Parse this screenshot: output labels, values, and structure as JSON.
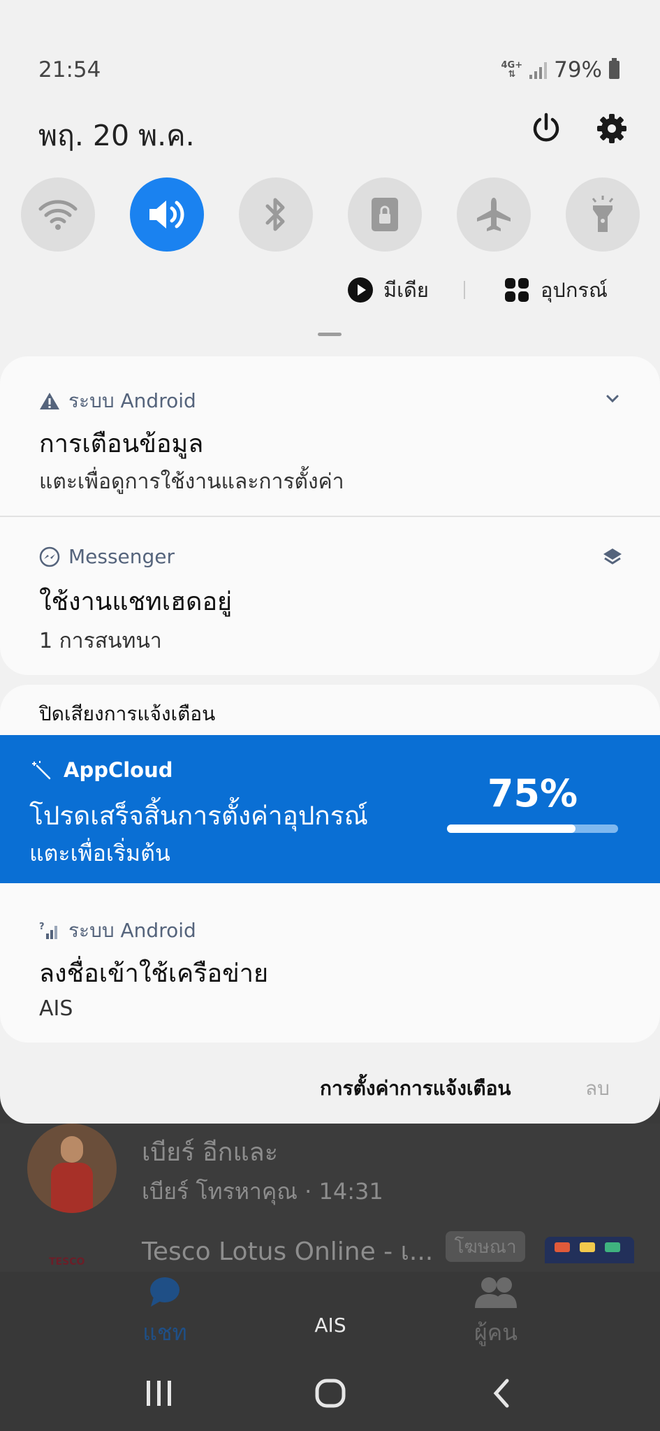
{
  "status_bar": {
    "time": "21:54",
    "network_type": "4G+",
    "battery": "79%"
  },
  "header": {
    "date": "พฤ. 20 พ.ค."
  },
  "quick_settings": [
    {
      "name": "wifi-icon",
      "active": false
    },
    {
      "name": "sound-icon",
      "active": true
    },
    {
      "name": "bluetooth-icon",
      "active": false
    },
    {
      "name": "screen-lock-icon",
      "active": false
    },
    {
      "name": "airplane-icon",
      "active": false
    },
    {
      "name": "flashlight-icon",
      "active": false
    }
  ],
  "media_row": {
    "media_label": "มีเดีย",
    "devices_label": "อุปกรณ์"
  },
  "notifications": {
    "android_alert": {
      "app": "ระบบ Android",
      "title": "การเตือนข้อมูล",
      "text": "แตะเพื่อดูการใช้งานและการตั้งค่า"
    },
    "messenger": {
      "app": "Messenger",
      "title": "ใช้งานแชทเฮดอยู่",
      "text": "1 การสนทนา"
    },
    "silent_section_title": "ปิดเสียงการแจ้งเตือน",
    "appcloud": {
      "app": "AppCloud",
      "title": "โปรดเสร็จสิ้นการตั้งค่าอุปกรณ์",
      "text": "แตะเพื่อเริ่มต้น",
      "progress_label": "75%",
      "progress_fraction": 0.75
    },
    "android_network": {
      "app": "ระบบ Android",
      "title": "ลงชื่อเข้าใช้เครือข่าย",
      "text": "AIS"
    },
    "footer": {
      "settings_label": "การตั้งค่าการแจ้งเตือน",
      "clear_label": "ลบ"
    }
  },
  "background_app": {
    "chat": {
      "name": "เบียร์ อีกและ",
      "subtitle": "เบียร์ โทรหาคุณ · 14:31"
    },
    "ad": {
      "logo_text": "TESCO",
      "name": "Tesco Lotus Online - เ...",
      "badge": "โฆษณา"
    },
    "nav": {
      "chats_label": "แชท",
      "carrier": "AIS",
      "people_label": "ผู้คน"
    }
  },
  "colors": {
    "accent": "#1a82f0",
    "appcloud_bg": "#0a6fd4",
    "panel_bg": "#f1f1f1"
  }
}
